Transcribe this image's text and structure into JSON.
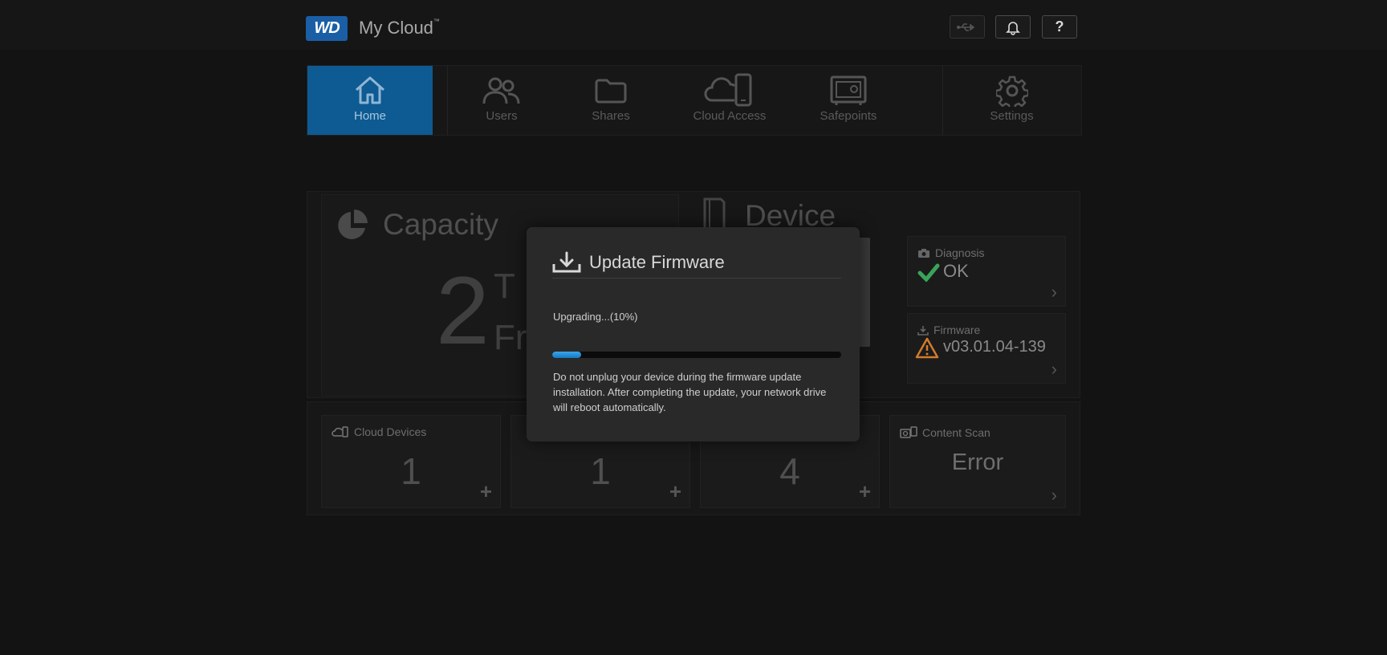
{
  "header": {
    "logo": "WD",
    "app_name": "My Cloud",
    "trademark": "™"
  },
  "nav": {
    "items": [
      {
        "label": "Home",
        "icon": "home-icon",
        "active": true
      },
      {
        "label": "Users",
        "icon": "users-icon"
      },
      {
        "label": "Shares",
        "icon": "folder-icon"
      },
      {
        "label": "Cloud Access",
        "icon": "cloud-phone-icon"
      },
      {
        "label": "Safepoints",
        "icon": "safe-icon"
      },
      {
        "label": "Settings",
        "icon": "gear-icon"
      }
    ]
  },
  "capacity": {
    "title": "Capacity",
    "value": "2",
    "unit_partial": "T",
    "free_partial": "Fr"
  },
  "device": {
    "title": "Device",
    "diagnosis": {
      "label": "Diagnosis",
      "value": "OK"
    },
    "firmware": {
      "label": "Firmware",
      "value": "v03.01.04-139"
    }
  },
  "tiles": {
    "cloud_devices": {
      "label": "Cloud Devices",
      "value": "1"
    },
    "users": {
      "value": "1"
    },
    "shares": {
      "value": "4"
    },
    "content_scan": {
      "label": "Content Scan",
      "value": "Error"
    }
  },
  "modal": {
    "title": "Update Firmware",
    "status": "Upgrading...(10%)",
    "progress": 0.1,
    "message": "Do not unplug your device during the firmware update installation. After completing the update, your network drive will reboot automatically."
  },
  "colors": {
    "accent": "#0e5a92",
    "progress": "#2a93dc",
    "ok": "#3aa35a",
    "warning": "#d27b2c"
  }
}
